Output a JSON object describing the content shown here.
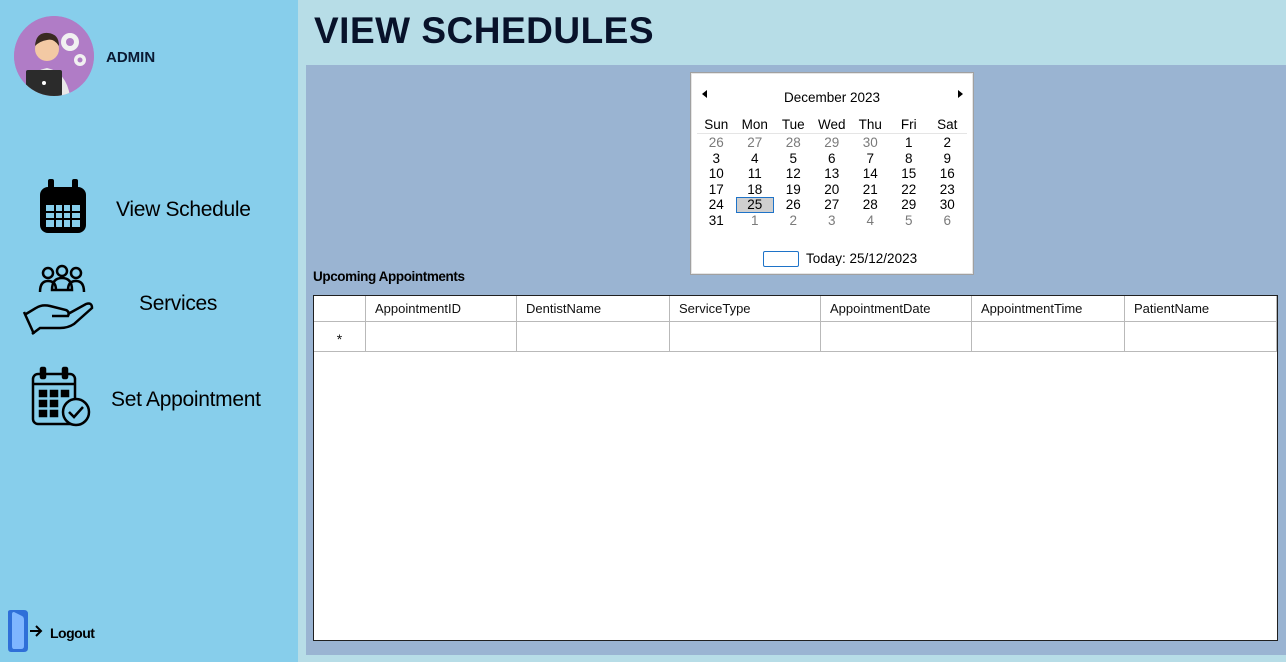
{
  "sidebar": {
    "user_label": "ADMIN",
    "nav": [
      {
        "label": "View Schedule",
        "icon": "calendar-icon"
      },
      {
        "label": "Services",
        "icon": "services-hand-icon"
      },
      {
        "label": "Set Appointment",
        "icon": "calendar-check-icon"
      }
    ],
    "logout_label": "Logout"
  },
  "header": {
    "title": "VIEW SCHEDULES"
  },
  "calendar": {
    "month_label": "December 2023",
    "weekdays": [
      "Sun",
      "Mon",
      "Tue",
      "Wed",
      "Thu",
      "Fri",
      "Sat"
    ],
    "weeks": [
      [
        "26",
        "27",
        "28",
        "29",
        "30",
        "1",
        "2"
      ],
      [
        "3",
        "4",
        "5",
        "6",
        "7",
        "8",
        "9"
      ],
      [
        "10",
        "11",
        "12",
        "13",
        "14",
        "15",
        "16"
      ],
      [
        "17",
        "18",
        "19",
        "20",
        "21",
        "22",
        "23"
      ],
      [
        "24",
        "25",
        "26",
        "27",
        "28",
        "29",
        "30"
      ],
      [
        "31",
        "1",
        "2",
        "3",
        "4",
        "5",
        "6"
      ]
    ],
    "selected_date": "25",
    "today_label": "Today: 25/12/2023"
  },
  "appointments": {
    "section_label": "Upcoming Appointments",
    "columns": [
      "AppointmentID",
      "DentistName",
      "ServiceType",
      "AppointmentDate",
      "AppointmentTime",
      "PatientName"
    ],
    "new_row_marker": "*",
    "rows": []
  },
  "colors": {
    "sidebar_bg": "#87ceeb",
    "header_bg": "#b7dde7",
    "content_bg": "#9ab4d2",
    "selection_border": "#1e73c8"
  }
}
